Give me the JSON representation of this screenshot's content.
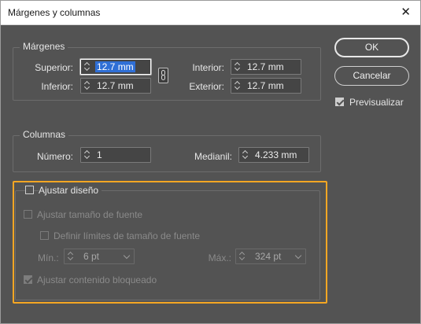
{
  "window": {
    "title": "Márgenes y columnas",
    "close_glyph": "✕"
  },
  "margins": {
    "label": "Márgenes",
    "top_label": "Superior:",
    "top_value": "12.7 mm",
    "bottom_label": "Inferior:",
    "bottom_value": "12.7 mm",
    "inside_label": "Interior:",
    "inside_value": "12.7 mm",
    "outside_label": "Exterior:",
    "outside_value": "12.7 mm"
  },
  "columns": {
    "label": "Columnas",
    "number_label": "Número:",
    "number_value": "1",
    "gutter_label": "Medianil:",
    "gutter_value": "4.233 mm"
  },
  "layout_adjust": {
    "label": "Ajustar diseño",
    "checked": false,
    "font_size_label": "Ajustar tamaño de fuente",
    "font_limits_label": "Definir límites de tamaño de fuente",
    "min_label": "Mín.:",
    "min_value": "6 pt",
    "max_label": "Máx.:",
    "max_value": "324 pt",
    "locked_label": "Ajustar contenido bloqueado",
    "locked_checked": true
  },
  "buttons": {
    "ok": "OK",
    "cancel": "Cancelar"
  },
  "preview": {
    "label": "Previsualizar",
    "checked": true
  },
  "colors": {
    "highlight": "#f5a623",
    "selection": "#2f6fd6",
    "panel": "#535353"
  }
}
